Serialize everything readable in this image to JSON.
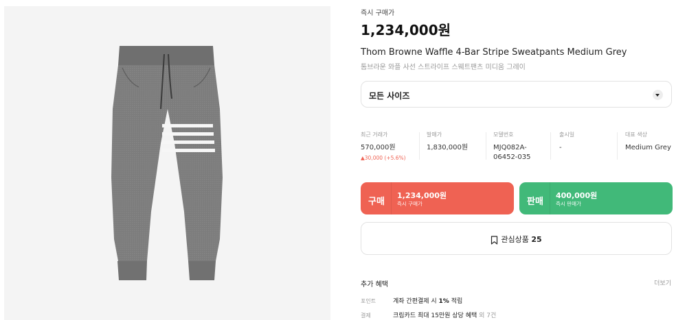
{
  "product_image": {
    "alt": "grey waffle sweatpants with 4-bar stripe"
  },
  "price_block": {
    "label": "즉시 구매가",
    "price": "1,234,000원"
  },
  "product": {
    "name_en": "Thom Browne Waffle 4-Bar Stripe Sweatpants Medium Grey",
    "name_ko": "톰브라운 와플 사선 스트라이프 스웨트팬츠 미디움 그레이"
  },
  "size_select": {
    "label": "모든 사이즈",
    "icon": "chevron-down-icon"
  },
  "stats": [
    {
      "label": "최근 거래가",
      "value": "570,000원",
      "change": "▲30,000 (+5.6%)"
    },
    {
      "label": "발매가",
      "value": "1,830,000원"
    },
    {
      "label": "모델번호",
      "value_line1": "MJQ082A-",
      "value_line2": "06452-035"
    },
    {
      "label": "출시일",
      "value": "-"
    },
    {
      "label": "대표 색상",
      "value": "Medium Grey"
    }
  ],
  "buy_button": {
    "tag": "구매",
    "amount": "1,234,000원",
    "sub": "즉시 구매가",
    "color": "#ef6253"
  },
  "sell_button": {
    "tag": "판매",
    "amount": "400,000원",
    "sub": "즉시 판매가",
    "color": "#41b979"
  },
  "wishlist": {
    "label": "관심상품",
    "count": "25",
    "icon": "bookmark-icon"
  },
  "benefits": {
    "title": "추가 혜택",
    "more": "더보기",
    "rows": [
      {
        "key": "포인트",
        "pre": "계좌 간편결제 시 ",
        "bold": "1%",
        "post": " 적립",
        "extra": ""
      },
      {
        "key": "결제",
        "pre": "크림카드 최대 15만원 상당 혜택",
        "bold": "",
        "post": "",
        "extra": " 외 7건"
      }
    ]
  }
}
